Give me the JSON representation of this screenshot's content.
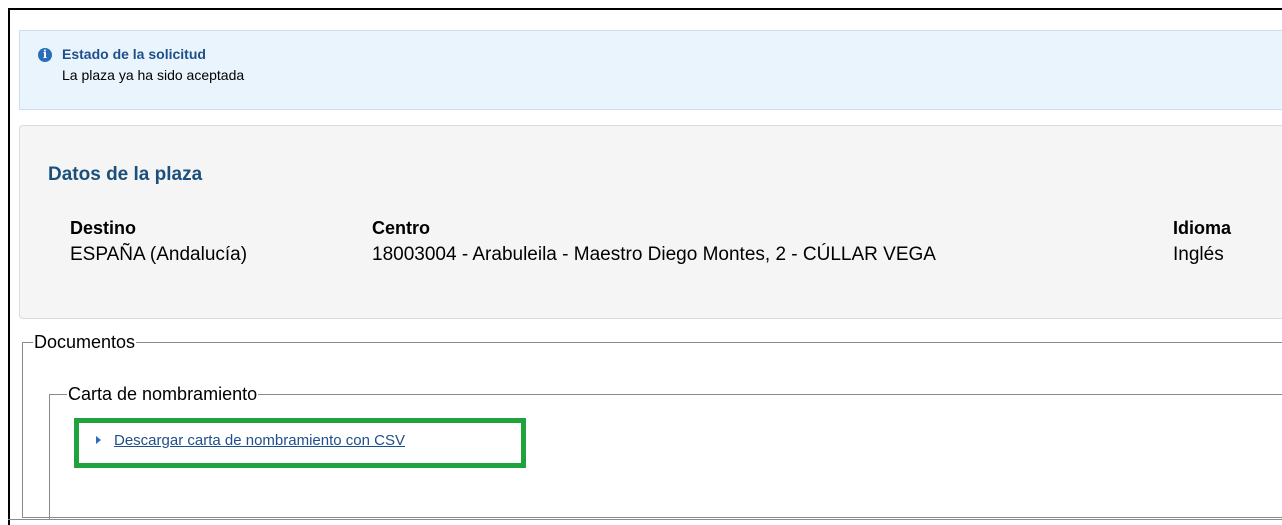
{
  "alert": {
    "icon": "info-icon",
    "title": "Estado de la solicitud",
    "text": "La plaza ya ha sido aceptada"
  },
  "plaza": {
    "title": "Datos de la plaza",
    "destino": {
      "label": "Destino",
      "value": "ESPAÑA (Andalucía)"
    },
    "centro": {
      "label": "Centro",
      "value": "18003004 - Arabuleila - Maestro Diego Montes, 2 - CÚLLAR VEGA"
    },
    "idioma": {
      "label": "Idioma",
      "value": "Inglés"
    }
  },
  "documentos": {
    "legend": "Documentos",
    "carta": {
      "legend": "Carta de nombramiento",
      "link_icon": "caret-right-icon",
      "link_text": "Descargar carta de nombramiento con CSV",
      "highlight_color": "#1fa33d"
    }
  }
}
